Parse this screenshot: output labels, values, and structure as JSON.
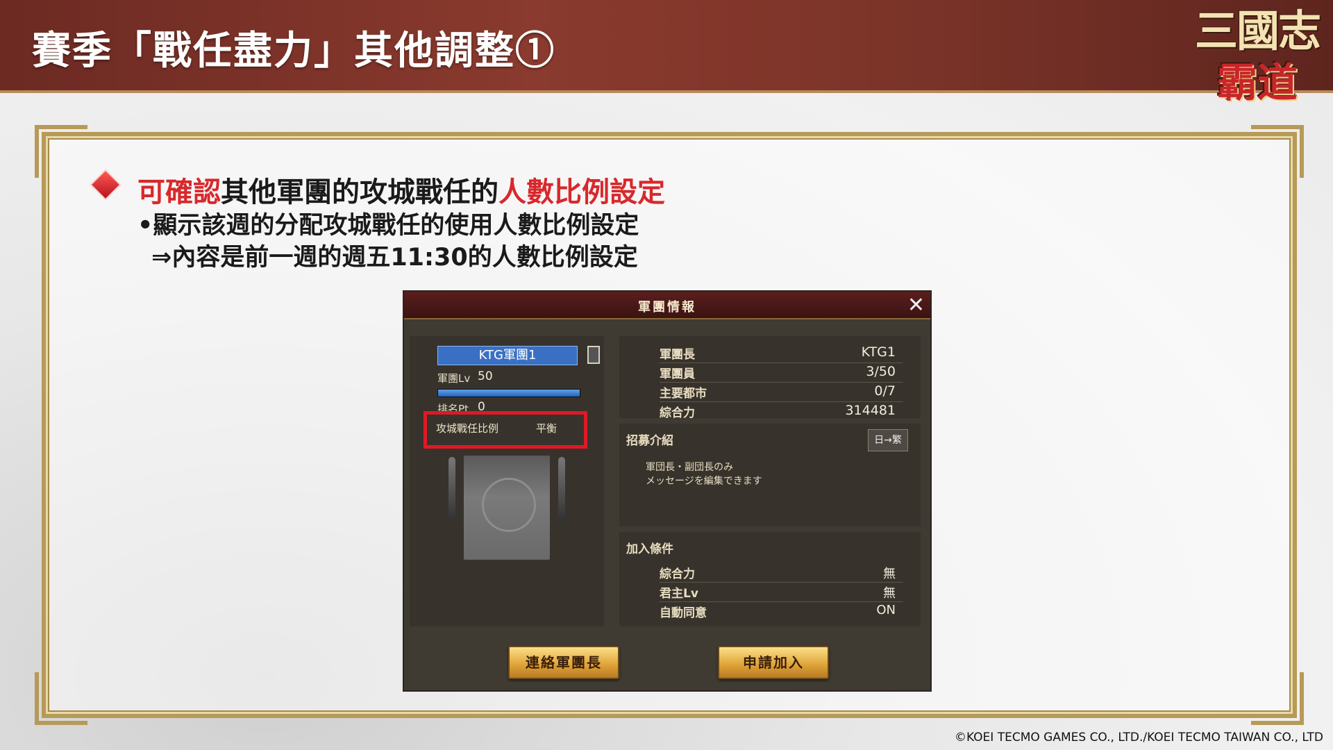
{
  "header": {
    "title": "賽季「戰任盡力」其他調整①",
    "logo_top": "三國志",
    "logo_bottom": "霸道"
  },
  "slide": {
    "heading_red1": "可確認",
    "heading_black": "其他軍團的攻城戰任的",
    "heading_red2": "人數比例設定",
    "sub1": "•顯示該週的分配攻城戰任的使用人數比例設定",
    "sub2": "⇒內容是前一週的週五11:30的人數比例設定"
  },
  "game_window": {
    "title": "軍團情報",
    "close_label": "✕",
    "left": {
      "guild_name": "KTG軍團1",
      "lv_label": "軍團Lv",
      "lv_value": "50",
      "lv_fill": 1.0,
      "rank_label": "排名Pt",
      "rank_value": "0",
      "siege_label": "攻城戰任比例",
      "siege_value": "平衡"
    },
    "info": [
      {
        "key": "軍團長",
        "value": "KTG1"
      },
      {
        "key": "軍團員",
        "value": "3/50"
      },
      {
        "key": "主要都市",
        "value": "0/7"
      },
      {
        "key": "綜合力",
        "value": "314481"
      }
    ],
    "recruit": {
      "title": "招募介紹",
      "translate_label": "日→繁",
      "text_line1": "軍団長・副団長のみ",
      "text_line2": "メッセージを編集できます"
    },
    "conditions": {
      "title": "加入條件",
      "rows": [
        {
          "key": "綜合力",
          "value": "無"
        },
        {
          "key": "君主Lv",
          "value": "無"
        },
        {
          "key": "自動同意",
          "value": "ON"
        }
      ]
    },
    "buttons": {
      "contact": "連絡軍團長",
      "apply": "申請加入"
    }
  },
  "copyright": "©KOEI TECMO GAMES CO., LTD./KOEI TECMO TAIWAN CO., LTD",
  "colors": {
    "accent_red": "#d8282c",
    "header_brown": "#7a3328",
    "gold_frame": "#b79a58",
    "highlight_box": "#e01825"
  }
}
